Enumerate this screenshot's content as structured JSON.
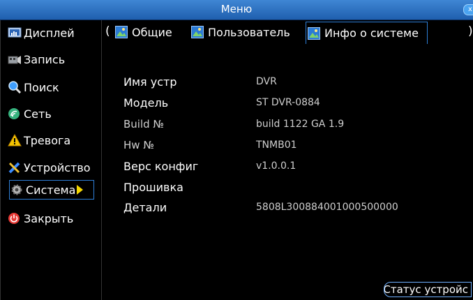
{
  "window": {
    "title": "Меню",
    "close_icon": "x"
  },
  "sidebar": {
    "items": [
      {
        "label": "Дисплей",
        "icon": "monitor-icon"
      },
      {
        "label": "Запись",
        "icon": "film-icon"
      },
      {
        "label": "Поиск",
        "icon": "search-icon"
      },
      {
        "label": "Сеть",
        "icon": "network-icon"
      },
      {
        "label": "Тревога",
        "icon": "warning-icon"
      },
      {
        "label": "Устройство",
        "icon": "tools-icon"
      },
      {
        "label": "Система",
        "icon": "gear-icon",
        "active": true
      },
      {
        "label": "Закрыть",
        "icon": "power-icon"
      }
    ]
  },
  "tabs": {
    "left_arrow": "(",
    "right_arrow": ")",
    "items": [
      {
        "label": "Общие",
        "icon": "image-icon"
      },
      {
        "label": "Пользователь",
        "icon": "image-icon"
      },
      {
        "label": "Инфо о системе",
        "icon": "image-icon",
        "active": true
      }
    ]
  },
  "info": {
    "rows": [
      {
        "label": "Имя устр",
        "value": "DVR"
      },
      {
        "label": "Модель",
        "value": "ST DVR-0884"
      },
      {
        "label": "Build №",
        "value": "build 1122 GA 1.9"
      },
      {
        "label": "Hw №",
        "value": "TNMB01"
      },
      {
        "label": "Верс конфиг",
        "value": "v1.0.0.1"
      },
      {
        "label": "Прошивка",
        "value": ""
      },
      {
        "label": "Детали",
        "value": "5808L300884001000500000"
      }
    ]
  },
  "status_button": {
    "label": "Статус устройс"
  },
  "colors": {
    "titlebar": "#2f74c5",
    "accent_border": "#2e7fd8",
    "arrow": "#f5d800"
  }
}
